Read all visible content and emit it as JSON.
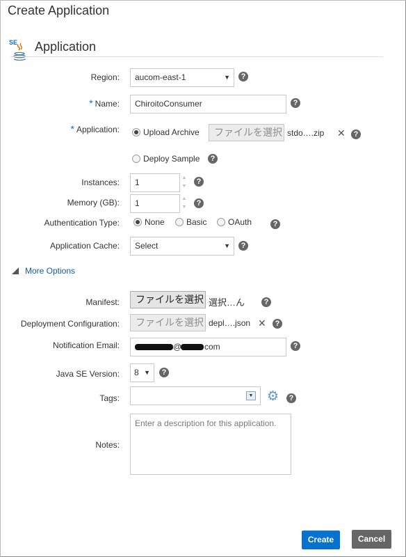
{
  "dialog": {
    "title": "Create Application"
  },
  "section": {
    "title": "Application",
    "icon": "java-se-icon"
  },
  "form": {
    "region": {
      "label": "Region:",
      "value": "aucom-east-1"
    },
    "name": {
      "required": "*",
      "label": "Name:",
      "value": "ChiroitoConsumer"
    },
    "application": {
      "required": "*",
      "label": "Application:",
      "upload_label": "Upload Archive",
      "upload_button": "ファイルを選択",
      "upload_file": "stdo….zip",
      "deploy_label": "Deploy Sample"
    },
    "instances": {
      "label": "Instances:",
      "value": "1"
    },
    "memory": {
      "label": "Memory (GB):",
      "value": "1"
    },
    "auth": {
      "label": "Authentication Type:",
      "options": [
        "None",
        "Basic",
        "OAuth"
      ],
      "selected": "None"
    },
    "cache": {
      "label": "Application Cache:",
      "value": "Select"
    },
    "more_options": {
      "label": "More Options"
    },
    "manifest": {
      "label": "Manifest:",
      "button": "ファイルを選択",
      "file": "選択…ん"
    },
    "deployment_config": {
      "label": "Deployment Configuration:",
      "button": "ファイルを選択",
      "file": "depl….json"
    },
    "notification_email": {
      "label": "Notification Email:",
      "value_at": "@",
      "value_suffix": "com"
    },
    "java_version": {
      "label": "Java SE Version:",
      "value": "8"
    },
    "tags": {
      "label": "Tags:",
      "value": ""
    },
    "notes": {
      "label": "Notes:",
      "placeholder": "Enter a description for this application."
    }
  },
  "footer": {
    "create_label": "Create",
    "cancel_label": "Cancel"
  },
  "colors": {
    "primary": "#0572ce",
    "secondary": "#666666",
    "link": "#145c9e"
  }
}
